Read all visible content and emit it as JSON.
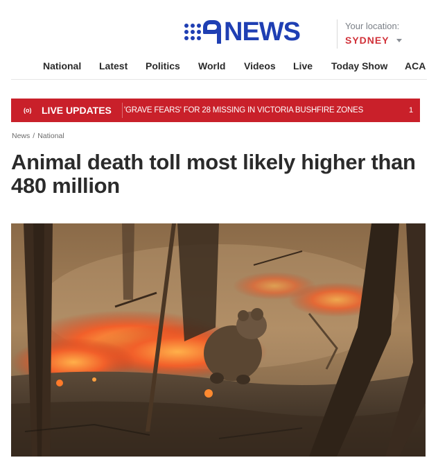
{
  "header": {
    "logo_text": "NEWS",
    "logo_icon": "nine-network-dots-logo",
    "brand_color": "#1f3fb3",
    "location_label": "Your location:",
    "location_city": "SYDNEY"
  },
  "nav": {
    "items": [
      {
        "label": "National"
      },
      {
        "label": "Latest"
      },
      {
        "label": "Politics"
      },
      {
        "label": "World"
      },
      {
        "label": "Videos"
      },
      {
        "label": "Live"
      },
      {
        "label": "Today Show"
      },
      {
        "label": "ACA"
      }
    ]
  },
  "ticker": {
    "icon": "broadcast-icon",
    "icon_text": "(o)",
    "live_label": "LIVE UPDATES",
    "headline": "'GRAVE FEARS' FOR 28 MISSING IN VICTORIA BUSHFIRE ZONES",
    "count": "1",
    "color": "#c9202a"
  },
  "breadcrumb": {
    "root": "News",
    "separator": "/",
    "section": "National"
  },
  "article": {
    "headline": "Animal death toll most likely higher than 480 million",
    "image_description_icon": "bushfire-koala-photo"
  }
}
